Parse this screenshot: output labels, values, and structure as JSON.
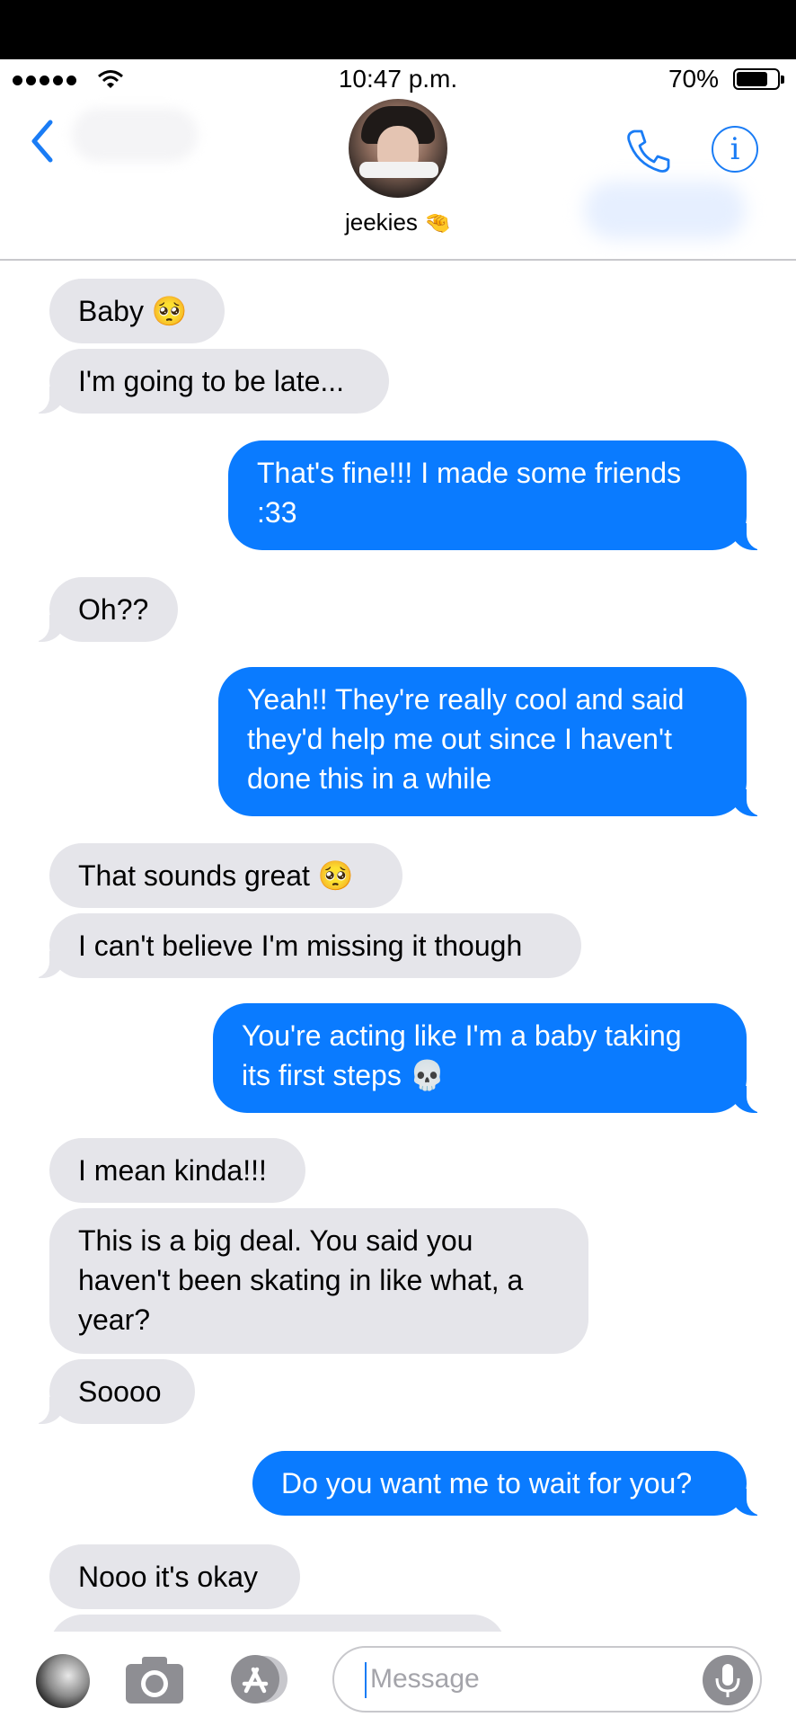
{
  "status_bar": {
    "time": "10:47 p.m.",
    "battery": "70%",
    "battery_level": 0.7
  },
  "header": {
    "contact_name": "jeekies",
    "name_emoji": "🤏"
  },
  "messages": [
    {
      "dir": "in",
      "text": "Baby 🥺",
      "tail": false
    },
    {
      "dir": "in",
      "text": "I'm going to be late...",
      "tail": true
    },
    {
      "dir": "out",
      "text": "That's fine!!! I made some friends :33",
      "tail": true
    },
    {
      "dir": "in",
      "text": "Oh??",
      "tail": true
    },
    {
      "dir": "out",
      "text": "Yeah!! They're really cool and said they'd help me out since I haven't done this in a while",
      "tail": true
    },
    {
      "dir": "in",
      "text": "That sounds great 🥺",
      "tail": false
    },
    {
      "dir": "in",
      "text": "I can't believe I'm missing it though",
      "tail": true
    },
    {
      "dir": "out",
      "text": "You're acting like I'm a baby taking its first steps 💀",
      "tail": true
    },
    {
      "dir": "in",
      "text": "I mean kinda!!!",
      "tail": false
    },
    {
      "dir": "in",
      "text": "This is a big deal. You said you haven't been skating in like what, a year?",
      "tail": false
    },
    {
      "dir": "in",
      "text": "Soooo",
      "tail": true
    },
    {
      "dir": "out",
      "text": "Do you want me to wait for you?",
      "tail": true
    },
    {
      "dir": "in",
      "text": "Nooo it's okay",
      "tail": false
    },
    {
      "dir": "in",
      "text": "",
      "tail": false
    }
  ],
  "composer": {
    "placeholder": "Message"
  }
}
